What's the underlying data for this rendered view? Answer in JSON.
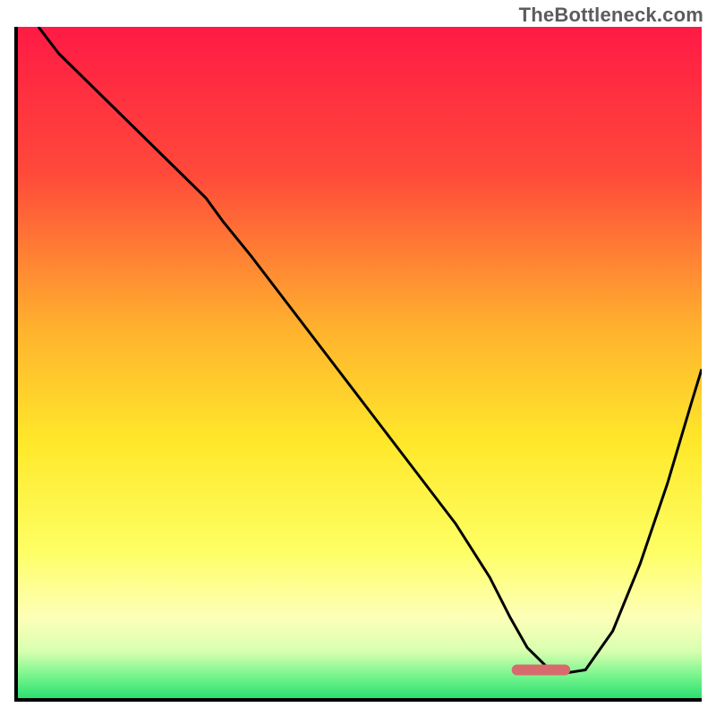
{
  "watermark": "TheBottleneck.com",
  "chart_data": {
    "type": "line",
    "title": "",
    "xlabel": "",
    "ylabel": "",
    "xlim": [
      0,
      100
    ],
    "ylim": [
      0,
      100
    ],
    "grid": false,
    "legend": false,
    "background": {
      "stops": [
        {
          "offset": 0.0,
          "color": "#ff1a45"
        },
        {
          "offset": 0.22,
          "color": "#ff4a3a"
        },
        {
          "offset": 0.45,
          "color": "#ffb22e"
        },
        {
          "offset": 0.62,
          "color": "#ffe82a"
        },
        {
          "offset": 0.78,
          "color": "#feff64"
        },
        {
          "offset": 0.88,
          "color": "#fdffb8"
        },
        {
          "offset": 0.93,
          "color": "#d8ffb0"
        },
        {
          "offset": 0.965,
          "color": "#7cf58f"
        },
        {
          "offset": 1.0,
          "color": "#2be070"
        }
      ]
    },
    "marker": {
      "x_range": [
        73,
        80
      ],
      "y": 4.2,
      "color": "#d86a6e",
      "thickness": 1.6
    },
    "series": [
      {
        "name": "bottleneck-curve",
        "color": "#000000",
        "width": 0.35,
        "x": [
          3,
          6,
          12,
          18,
          24,
          27.5,
          30,
          34,
          40,
          46,
          52,
          58,
          64,
          69,
          72,
          74.5,
          78,
          80.5,
          83,
          87,
          91,
          95,
          98.5,
          100
        ],
        "values": [
          100,
          96,
          90,
          84,
          78,
          74.5,
          71,
          66,
          58,
          50,
          42,
          34,
          26,
          18,
          12,
          7.5,
          4,
          3.8,
          4.2,
          10,
          20,
          32,
          44,
          49
        ]
      }
    ]
  }
}
